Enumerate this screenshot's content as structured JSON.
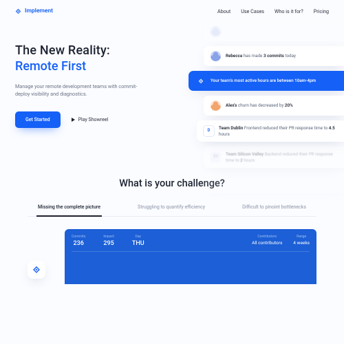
{
  "brand": "Implement",
  "nav": {
    "about": "About",
    "use_cases": "Use Cases",
    "who": "Who is it for?",
    "pricing": "Pricing"
  },
  "hero": {
    "title1": "The New Reality:",
    "title2": "Remote First",
    "subtitle": "Manage your remote development teams with commit-deploy visibility and diagnostics.",
    "cta": "Get Started",
    "play": "Play Showreel"
  },
  "feed": {
    "c1_name": "Rebecca",
    "c1_mid": " has made ",
    "c1_b": "3 commits",
    "c1_end": " today",
    "c2_a": "Your team's most active hours are between ",
    "c2_b": "10am-4pm",
    "c3_name": "Alex's",
    "c3_mid": " churn has decreased by ",
    "c3_b": "20%",
    "c4_team": "Team Dublin",
    "c4_rest": " Frontend reduced their PR response time to ",
    "c4_b": "4.5",
    "c4_end": " hours",
    "c5_team": "Team Silicon Valley",
    "c5_rest": " Backend reduced their PR response time to ",
    "c5_b": "2",
    "c5_end": " hours",
    "chip_d": "D",
    "chip_sv": "SV"
  },
  "challenge": {
    "title": "What is your challenge?",
    "tab1": "Missing the complete picture",
    "tab2": "Struggling to quantify efficiency",
    "tab3": "Difficult to pinoint bottlenecks"
  },
  "panel": {
    "commits_lbl": "Commits",
    "commits_val": "236",
    "impact_lbl": "Impact",
    "impact_val": "295",
    "day_lbl": "Day",
    "day_val": "THU",
    "s1_lbl": "Contributors",
    "s1_val": "All contributors",
    "s2_lbl": "Range",
    "s2_val": "4 weeks"
  }
}
